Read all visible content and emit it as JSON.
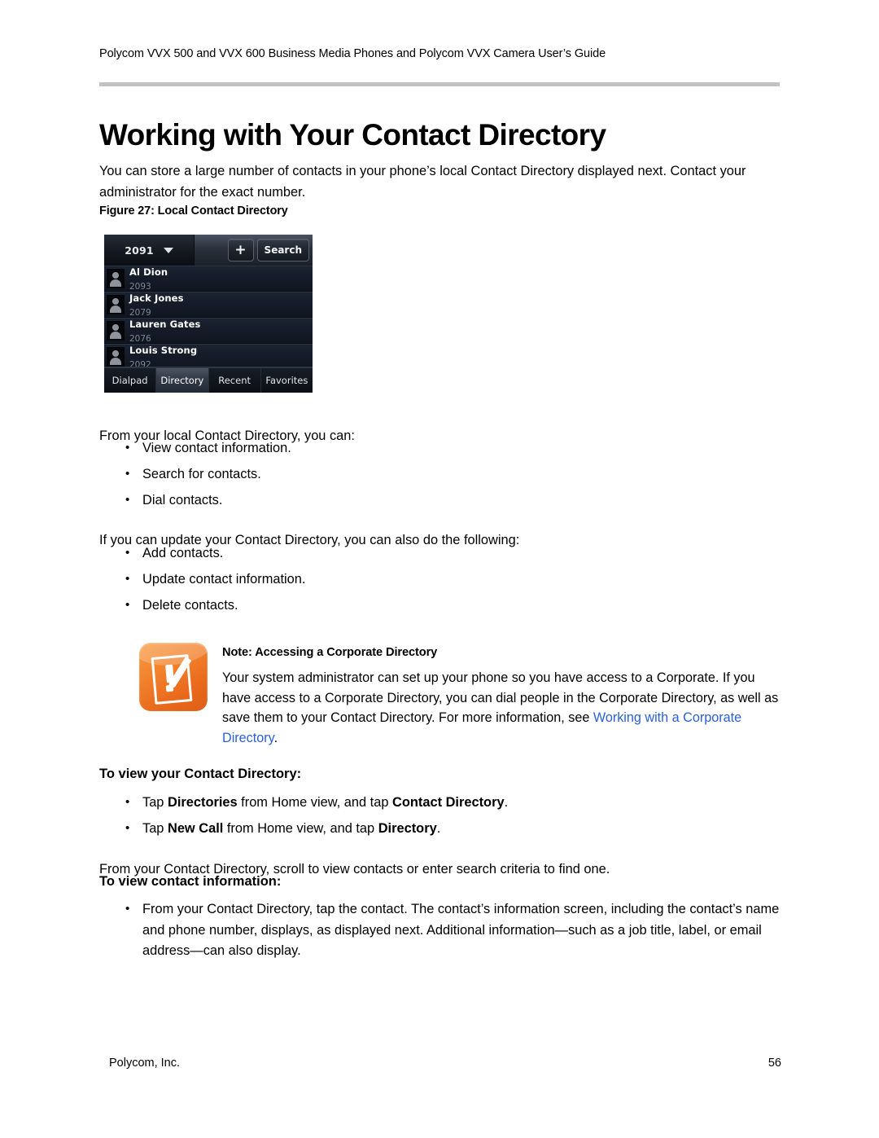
{
  "header": {
    "running_head": "Polycom VVX 500 and VVX 600 Business Media Phones and Polycom VVX Camera User’s Guide",
    "title": "Working with Your Contact Directory"
  },
  "intro": {
    "paragraph": "You can store a large number of contacts in your phone’s local Contact Directory displayed next. Contact your administrator for the exact number."
  },
  "figure": {
    "caption": "Figure 27: Local Contact Directory",
    "phone": {
      "line_label": "2091",
      "caret_icon": "chevron-down-icon",
      "add_button": "+",
      "search_button": "Search",
      "contacts": [
        {
          "name": "Al Dion",
          "number": "2093"
        },
        {
          "name": "Jack Jones",
          "number": "2079"
        },
        {
          "name": "Lauren Gates",
          "number": "2076"
        },
        {
          "name": "Louis Strong",
          "number": "2092"
        }
      ],
      "tabs": [
        {
          "label": "Dialpad",
          "active": false
        },
        {
          "label": "Directory",
          "active": true
        },
        {
          "label": "Recent",
          "active": false
        },
        {
          "label": "Favorites",
          "active": false
        }
      ]
    }
  },
  "capabilities": {
    "lead": "From your local Contact Directory, you can:",
    "items": [
      "View contact information.",
      "Search for contacts.",
      "Dial contacts."
    ]
  },
  "update_capabilities": {
    "lead": "If you can update your Contact Directory, you can also do the following:",
    "items": [
      "Add contacts.",
      "Update contact information.",
      "Delete contacts."
    ]
  },
  "note": {
    "icon": "note-pencil-icon",
    "title": "Note: Accessing a Corporate Directory",
    "body_before_link": "Your system administrator can set up your phone so you have access to a Corporate. If you have access to a Corporate Directory, you can dial people in the Corporate Directory, as well as save them to your Contact Directory. For more information, see ",
    "link_text": "Working with a Corporate Directory",
    "body_after_link": ".",
    "link_color": "#2a5fd8"
  },
  "view_directory": {
    "heading": "To view your Contact Directory:",
    "items": [
      {
        "pre": "Tap ",
        "bold1": "Directories",
        "mid": " from Home view, and tap ",
        "bold2": "Contact Directory",
        "post": "."
      },
      {
        "pre": "Tap ",
        "bold1": "New Call",
        "mid": " from Home view, and tap ",
        "bold2": "Directory",
        "post": "."
      }
    ],
    "follow_up": "From your Contact Directory, scroll to view contacts or enter search criteria to find one."
  },
  "view_contact_info": {
    "heading": "To view contact information:",
    "items": [
      "From your Contact Directory, tap the contact. The contact’s information screen, including the contact’s name and phone number, displays, as displayed next. Additional information—such as a job title, label, or email address—can also display."
    ]
  },
  "footer": {
    "company": "Polycom, Inc.",
    "page_number": "56"
  }
}
